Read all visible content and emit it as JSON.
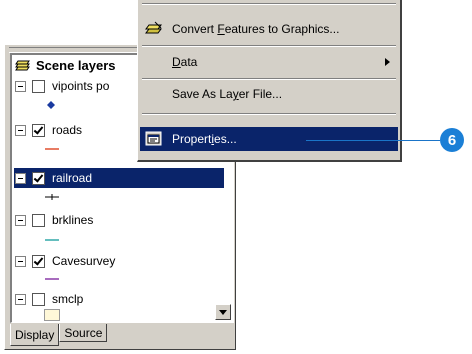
{
  "toc": {
    "group_label": "Scene layers",
    "layers": [
      {
        "label": "vipoints po",
        "checked": false,
        "selected": false,
        "symbol": "point-symbol"
      },
      {
        "label": "roads",
        "checked": true,
        "selected": false,
        "symbol": "line-symbol"
      },
      {
        "label": "railroad",
        "checked": true,
        "selected": true,
        "symbol": "railroad-symbol"
      },
      {
        "label": "brklines",
        "checked": false,
        "selected": false,
        "symbol": "line-symbol"
      },
      {
        "label": "Cavesurvey",
        "checked": true,
        "selected": false,
        "symbol": "line-symbol"
      },
      {
        "label": "smclp",
        "checked": false,
        "selected": false,
        "symbol": "fill-symbol"
      }
    ],
    "tabs": {
      "display": "Display",
      "source": "Source"
    },
    "colors": {
      "roads": "#e05030",
      "brklines": "#30a8a8",
      "cavesurvey": "#8a3aa8",
      "smclp_fill": "#fff8d8",
      "vipoints": "#1a3aa0"
    }
  },
  "menu": {
    "convert_pre": "Convert ",
    "convert_key": "F",
    "convert_post": "eatures to Graphics...",
    "data_key": "D",
    "data_post": "ata",
    "save_pre": "Save As La",
    "save_key": "y",
    "save_post": "er File...",
    "props_pre": "Propert",
    "props_key": "i",
    "props_post": "es..."
  },
  "callout": {
    "step": "6"
  },
  "colors": {
    "selection": "#0a246a",
    "callout": "#1b7fd6"
  }
}
